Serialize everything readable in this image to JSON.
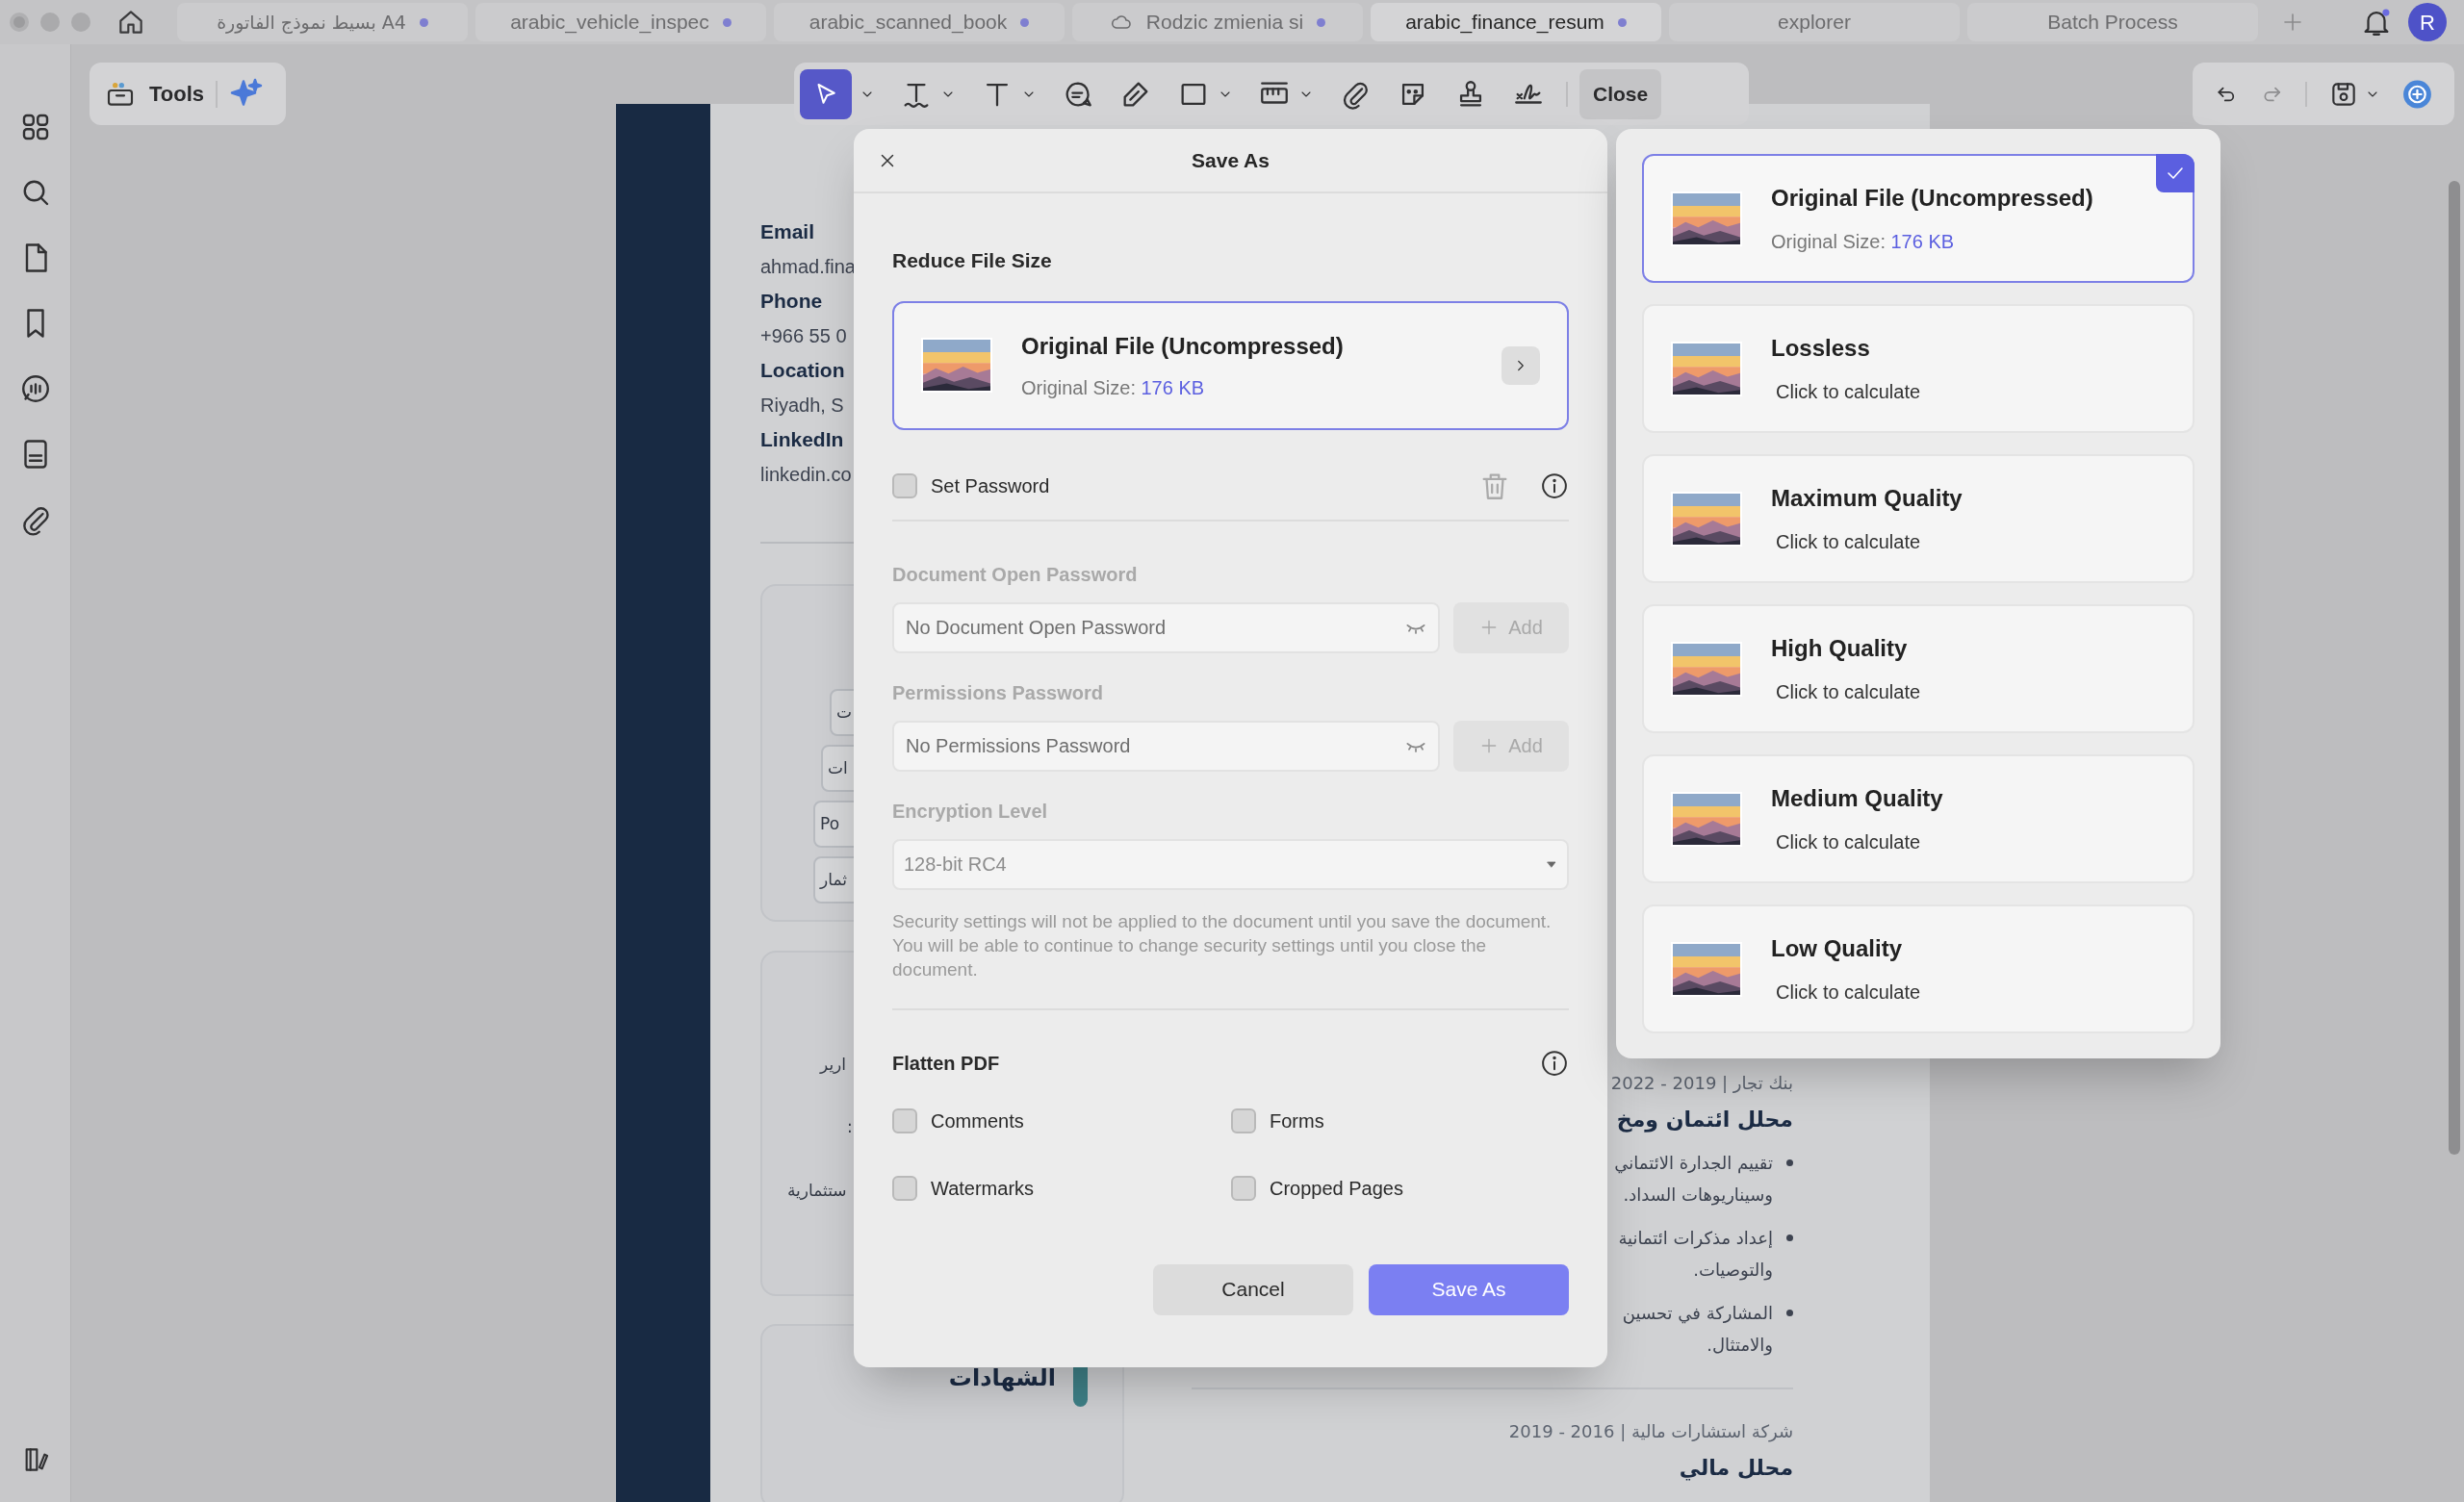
{
  "window": {
    "user_initial": "R"
  },
  "tabs": [
    {
      "label": "بسيط نموذج الفاتورة A4",
      "selected": false,
      "cloud": false,
      "dot": true
    },
    {
      "label": "arabic_vehicle_inspec",
      "selected": false,
      "cloud": false,
      "dot": true
    },
    {
      "label": "arabic_scanned_book",
      "selected": false,
      "cloud": false,
      "dot": true
    },
    {
      "label": "Rodzic zmienia si",
      "selected": false,
      "cloud": true,
      "dot": true
    },
    {
      "label": "arabic_finance_resum",
      "selected": true,
      "cloud": false,
      "dot": true
    },
    {
      "label": "explorer",
      "selected": false,
      "cloud": false,
      "dot": false
    },
    {
      "label": "Batch Process",
      "selected": false,
      "cloud": false,
      "dot": false
    }
  ],
  "toolbar": {
    "tools_label": "Tools",
    "close_label": "Close"
  },
  "document": {
    "contact": [
      {
        "kind": "label",
        "text": "Email"
      },
      {
        "kind": "value",
        "text": "ahmad.fina"
      },
      {
        "kind": "label",
        "text": "Phone"
      },
      {
        "kind": "value",
        "text": "+966 55 0"
      },
      {
        "kind": "label",
        "text": "Location"
      },
      {
        "kind": "value",
        "text": "Riyadh, S"
      },
      {
        "kind": "label",
        "text": "LinkedIn"
      },
      {
        "kind": "value",
        "text": "linkedin.co"
      }
    ],
    "chips": [
      "ت",
      "ات",
      "Po",
      "ثمار"
    ],
    "card_lines": [
      "ارير",
      ":",
      "ستثمارية"
    ],
    "certificates_heading": "الشهادات",
    "jobs": [
      {
        "period": "بنك تجار | 2019 - 2022",
        "title": "محلل ائتمان ومخ",
        "bullets": [
          "تقييم الجدارة الائتماني\nوسيناريوهات السداد.",
          "إعداد مذكرات ائتمانية\nوالتوصيات.",
          "المشاركة في تحسين\nوالامتثال."
        ]
      },
      {
        "period": "شركة استشارات مالية | 2016 - 2019",
        "title": "محلل مالي"
      }
    ]
  },
  "dialog": {
    "title": "Save As",
    "reduce_heading": "Reduce File Size",
    "current": {
      "title": "Original File (Uncompressed)",
      "size_label": "Original Size: ",
      "size_value": "176 KB"
    },
    "set_password": {
      "label": "Set Password",
      "checked": false
    },
    "open_password": {
      "label": "Document Open Password",
      "placeholder": "No Document Open Password",
      "add_label": "Add",
      "disabled": true
    },
    "permissions_password": {
      "label": "Permissions Password",
      "placeholder": "No Permissions Password",
      "add_label": "Add",
      "disabled": true
    },
    "encryption": {
      "label": "Encryption Level",
      "value": "128-bit RC4",
      "disabled": true
    },
    "note": "Security settings will not be applied to the document until you save the document. You will be able to continue to change security settings until you close the document.",
    "flatten_heading": "Flatten PDF",
    "flatten_options": [
      {
        "label": "Comments",
        "checked": false
      },
      {
        "label": "Forms",
        "checked": false
      },
      {
        "label": "Watermarks",
        "checked": false
      },
      {
        "label": "Cropped Pages",
        "checked": false
      }
    ],
    "buttons": [
      {
        "kind": "secondary",
        "label": "Cancel"
      },
      {
        "kind": "primary",
        "label": "Save As"
      }
    ]
  },
  "compression_options": [
    {
      "title": "Original File (Uncompressed)",
      "size_label": "Original Size: ",
      "size_value": "176 KB",
      "selected": true
    },
    {
      "title": "Lossless",
      "detail": "Click to calculate",
      "selected": false
    },
    {
      "title": "Maximum Quality",
      "detail": "Click to calculate",
      "selected": false
    },
    {
      "title": "High Quality",
      "detail": "Click to calculate",
      "selected": false
    },
    {
      "title": "Medium Quality",
      "detail": "Click to calculate",
      "selected": false
    },
    {
      "title": "Low Quality",
      "detail": "Click to calculate",
      "selected": false
    }
  ]
}
